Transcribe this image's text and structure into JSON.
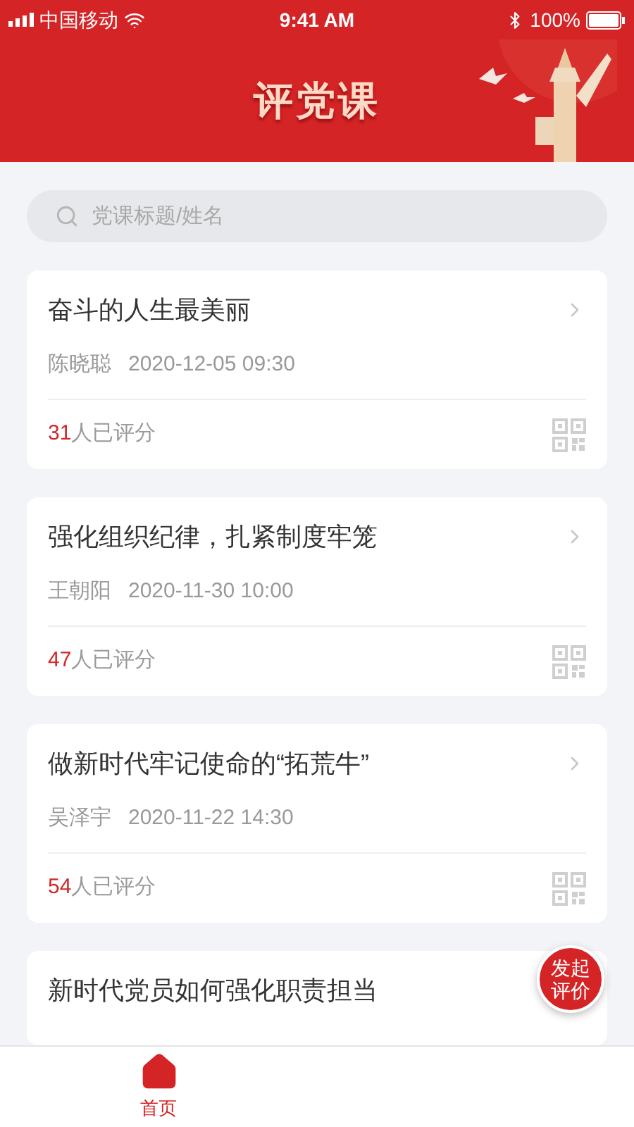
{
  "status_bar": {
    "carrier": "中国移动",
    "time": "9:41 AM",
    "battery": "100%"
  },
  "header": {
    "title": "评党课"
  },
  "search": {
    "placeholder": "党课标题/姓名"
  },
  "courses": [
    {
      "title": "奋斗的人生最美丽",
      "author": "陈晓聪",
      "datetime": "2020-12-05 09:30",
      "count": "31",
      "count_suffix": "人已评分"
    },
    {
      "title": "强化组织纪律，扎紧制度牢笼",
      "author": "王朝阳",
      "datetime": "2020-11-30 10:00",
      "count": "47",
      "count_suffix": "人已评分"
    },
    {
      "title": "做新时代牢记使命的“拓荒牛”",
      "author": "吴泽宇",
      "datetime": "2020-11-22 14:30",
      "count": "54",
      "count_suffix": "人已评分"
    },
    {
      "title": "新时代党员如何强化职责担当"
    }
  ],
  "fab": {
    "label": "发起评价"
  },
  "tab_bar": [
    {
      "label": "首页",
      "selected": true
    }
  ]
}
